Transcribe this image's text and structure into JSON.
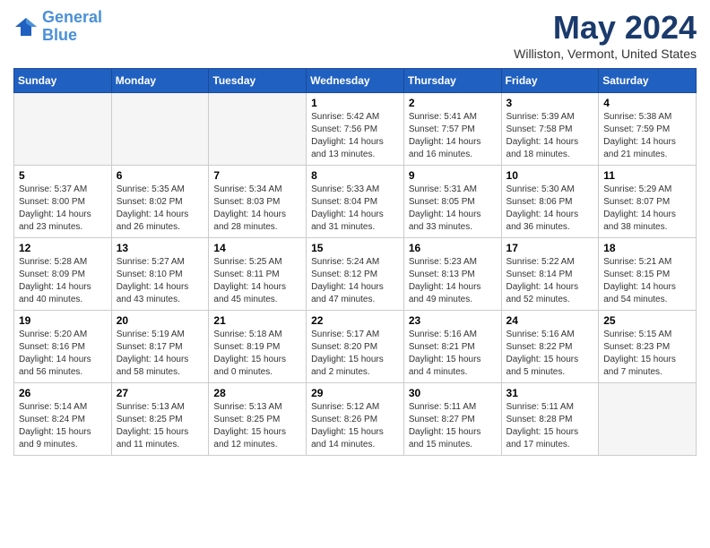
{
  "header": {
    "logo_line1": "General",
    "logo_line2": "Blue",
    "month_title": "May 2024",
    "location": "Williston, Vermont, United States"
  },
  "weekdays": [
    "Sunday",
    "Monday",
    "Tuesday",
    "Wednesday",
    "Thursday",
    "Friday",
    "Saturday"
  ],
  "weeks": [
    [
      {
        "day": "",
        "info": ""
      },
      {
        "day": "",
        "info": ""
      },
      {
        "day": "",
        "info": ""
      },
      {
        "day": "1",
        "info": "Sunrise: 5:42 AM\nSunset: 7:56 PM\nDaylight: 14 hours\nand 13 minutes."
      },
      {
        "day": "2",
        "info": "Sunrise: 5:41 AM\nSunset: 7:57 PM\nDaylight: 14 hours\nand 16 minutes."
      },
      {
        "day": "3",
        "info": "Sunrise: 5:39 AM\nSunset: 7:58 PM\nDaylight: 14 hours\nand 18 minutes."
      },
      {
        "day": "4",
        "info": "Sunrise: 5:38 AM\nSunset: 7:59 PM\nDaylight: 14 hours\nand 21 minutes."
      }
    ],
    [
      {
        "day": "5",
        "info": "Sunrise: 5:37 AM\nSunset: 8:00 PM\nDaylight: 14 hours\nand 23 minutes."
      },
      {
        "day": "6",
        "info": "Sunrise: 5:35 AM\nSunset: 8:02 PM\nDaylight: 14 hours\nand 26 minutes."
      },
      {
        "day": "7",
        "info": "Sunrise: 5:34 AM\nSunset: 8:03 PM\nDaylight: 14 hours\nand 28 minutes."
      },
      {
        "day": "8",
        "info": "Sunrise: 5:33 AM\nSunset: 8:04 PM\nDaylight: 14 hours\nand 31 minutes."
      },
      {
        "day": "9",
        "info": "Sunrise: 5:31 AM\nSunset: 8:05 PM\nDaylight: 14 hours\nand 33 minutes."
      },
      {
        "day": "10",
        "info": "Sunrise: 5:30 AM\nSunset: 8:06 PM\nDaylight: 14 hours\nand 36 minutes."
      },
      {
        "day": "11",
        "info": "Sunrise: 5:29 AM\nSunset: 8:07 PM\nDaylight: 14 hours\nand 38 minutes."
      }
    ],
    [
      {
        "day": "12",
        "info": "Sunrise: 5:28 AM\nSunset: 8:09 PM\nDaylight: 14 hours\nand 40 minutes."
      },
      {
        "day": "13",
        "info": "Sunrise: 5:27 AM\nSunset: 8:10 PM\nDaylight: 14 hours\nand 43 minutes."
      },
      {
        "day": "14",
        "info": "Sunrise: 5:25 AM\nSunset: 8:11 PM\nDaylight: 14 hours\nand 45 minutes."
      },
      {
        "day": "15",
        "info": "Sunrise: 5:24 AM\nSunset: 8:12 PM\nDaylight: 14 hours\nand 47 minutes."
      },
      {
        "day": "16",
        "info": "Sunrise: 5:23 AM\nSunset: 8:13 PM\nDaylight: 14 hours\nand 49 minutes."
      },
      {
        "day": "17",
        "info": "Sunrise: 5:22 AM\nSunset: 8:14 PM\nDaylight: 14 hours\nand 52 minutes."
      },
      {
        "day": "18",
        "info": "Sunrise: 5:21 AM\nSunset: 8:15 PM\nDaylight: 14 hours\nand 54 minutes."
      }
    ],
    [
      {
        "day": "19",
        "info": "Sunrise: 5:20 AM\nSunset: 8:16 PM\nDaylight: 14 hours\nand 56 minutes."
      },
      {
        "day": "20",
        "info": "Sunrise: 5:19 AM\nSunset: 8:17 PM\nDaylight: 14 hours\nand 58 minutes."
      },
      {
        "day": "21",
        "info": "Sunrise: 5:18 AM\nSunset: 8:19 PM\nDaylight: 15 hours\nand 0 minutes."
      },
      {
        "day": "22",
        "info": "Sunrise: 5:17 AM\nSunset: 8:20 PM\nDaylight: 15 hours\nand 2 minutes."
      },
      {
        "day": "23",
        "info": "Sunrise: 5:16 AM\nSunset: 8:21 PM\nDaylight: 15 hours\nand 4 minutes."
      },
      {
        "day": "24",
        "info": "Sunrise: 5:16 AM\nSunset: 8:22 PM\nDaylight: 15 hours\nand 5 minutes."
      },
      {
        "day": "25",
        "info": "Sunrise: 5:15 AM\nSunset: 8:23 PM\nDaylight: 15 hours\nand 7 minutes."
      }
    ],
    [
      {
        "day": "26",
        "info": "Sunrise: 5:14 AM\nSunset: 8:24 PM\nDaylight: 15 hours\nand 9 minutes."
      },
      {
        "day": "27",
        "info": "Sunrise: 5:13 AM\nSunset: 8:25 PM\nDaylight: 15 hours\nand 11 minutes."
      },
      {
        "day": "28",
        "info": "Sunrise: 5:13 AM\nSunset: 8:25 PM\nDaylight: 15 hours\nand 12 minutes."
      },
      {
        "day": "29",
        "info": "Sunrise: 5:12 AM\nSunset: 8:26 PM\nDaylight: 15 hours\nand 14 minutes."
      },
      {
        "day": "30",
        "info": "Sunrise: 5:11 AM\nSunset: 8:27 PM\nDaylight: 15 hours\nand 15 minutes."
      },
      {
        "day": "31",
        "info": "Sunrise: 5:11 AM\nSunset: 8:28 PM\nDaylight: 15 hours\nand 17 minutes."
      },
      {
        "day": "",
        "info": ""
      }
    ]
  ]
}
